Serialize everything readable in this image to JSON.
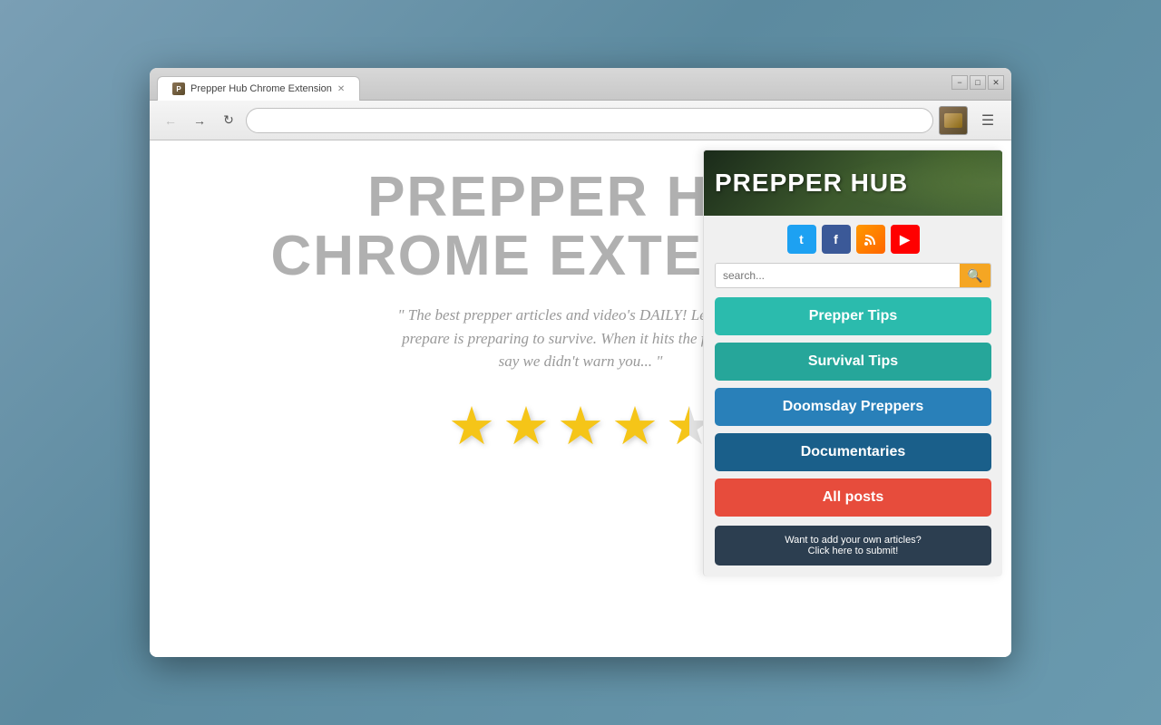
{
  "browser": {
    "tab_label": "Prepper Hub Chrome Extension",
    "address_bar_value": "",
    "address_placeholder": ""
  },
  "page": {
    "main_title_line1": "PREPPER HUB",
    "main_title_line2": "CHROME EXTENSION",
    "subtitle": "\" The best prepper articles and video's DAILY! Learning to prepare is preparing to survive. When it hits the fan, don't say we didn't warn you... \"",
    "stars_filled": 4,
    "stars_half": 1,
    "stars_total": 5
  },
  "popup": {
    "header_title": "PREPPER HUB",
    "search_placeholder": "search...",
    "search_button_label": "🔍",
    "nav_buttons": [
      {
        "label": "Prepper Tips",
        "color_class": "btn-green"
      },
      {
        "label": "Survival Tips",
        "color_class": "btn-teal"
      },
      {
        "label": "Doomsday Preppers",
        "color_class": "btn-blue"
      },
      {
        "label": "Documentaries",
        "color_class": "btn-navy"
      },
      {
        "label": "All posts",
        "color_class": "btn-red"
      }
    ],
    "submit_label": "Want to add your own articles?\nClick here to submit!",
    "social_icons": [
      {
        "name": "twitter",
        "symbol": "t"
      },
      {
        "name": "facebook",
        "symbol": "f"
      },
      {
        "name": "rss",
        "symbol": "◈"
      },
      {
        "name": "youtube",
        "symbol": "▶"
      }
    ]
  },
  "window_controls": {
    "minimize": "−",
    "restore": "□",
    "close": "✕"
  }
}
